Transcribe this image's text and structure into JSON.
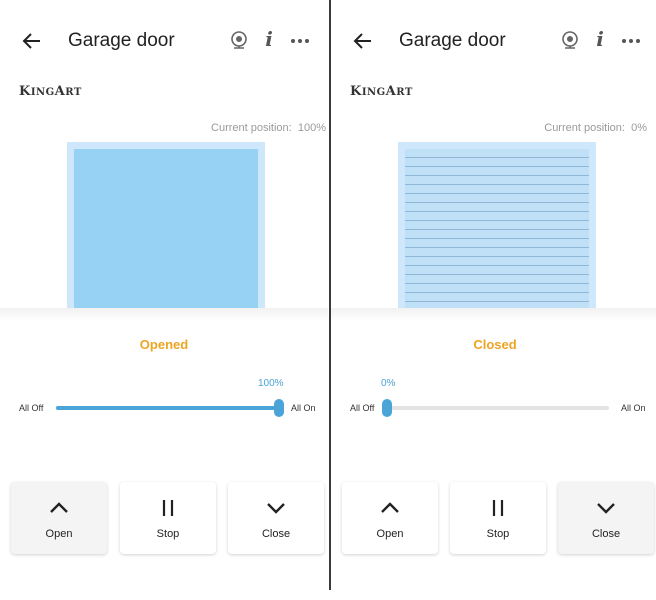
{
  "panels": [
    {
      "header": {
        "title": "Garage door",
        "back_icon": "back-arrow-icon",
        "camera_icon": "webcam-icon",
        "info_icon": "info-icon",
        "more_icon": "more-icon"
      },
      "brand": {
        "logo_text": "KingArt"
      },
      "position": {
        "label": "Current position:",
        "value": "100%"
      },
      "door_state": "opened",
      "status": "Opened",
      "slider": {
        "min_label": "All Off",
        "max_label": "All On",
        "value_label": "100%",
        "value": 100
      },
      "buttons": [
        {
          "label": "Open",
          "icon": "chevron-up-icon"
        },
        {
          "label": "Stop",
          "icon": "pause-icon"
        },
        {
          "label": "Close",
          "icon": "chevron-down-icon"
        }
      ]
    },
    {
      "header": {
        "title": "Garage door",
        "back_icon": "back-arrow-icon",
        "camera_icon": "webcam-icon",
        "info_icon": "info-icon",
        "more_icon": "more-icon"
      },
      "brand": {
        "logo_text": "KingArt"
      },
      "position": {
        "label": "Current position:",
        "value": "0%"
      },
      "door_state": "closed",
      "status": "Closed",
      "slider": {
        "min_label": "All Off",
        "max_label": "All On",
        "value_label": "0%",
        "value": 0
      },
      "buttons": [
        {
          "label": "Open",
          "icon": "chevron-up-icon"
        },
        {
          "label": "Stop",
          "icon": "pause-icon"
        },
        {
          "label": "Close",
          "icon": "chevron-down-icon"
        }
      ]
    }
  ],
  "colors": {
    "accent": "#4aa4d8",
    "status": "#eda524",
    "door_open": "#97d1f3",
    "door_frame": "#cfe7fa"
  }
}
